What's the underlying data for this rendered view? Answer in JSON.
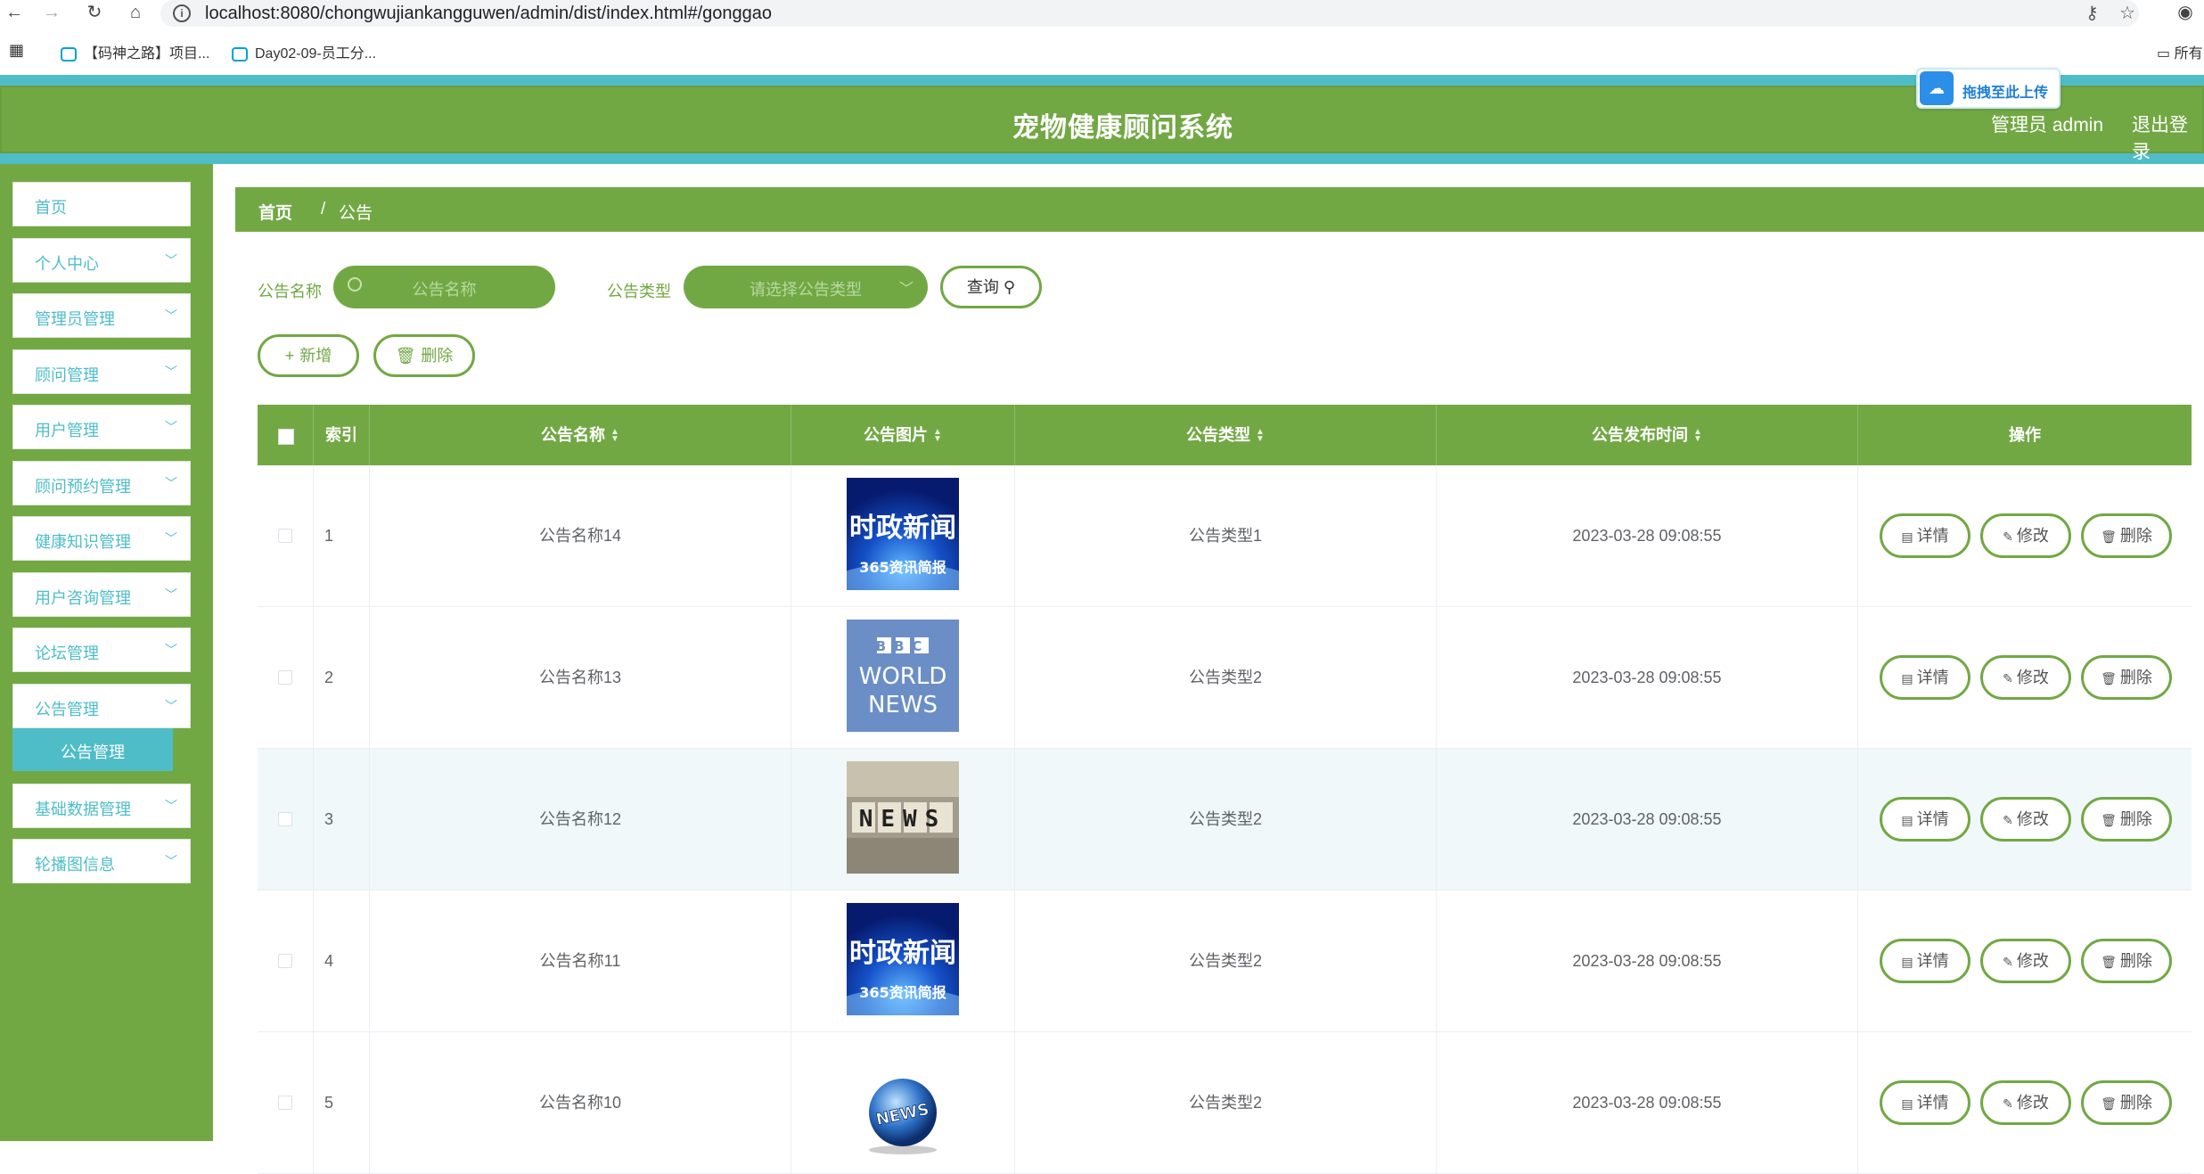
{
  "browser": {
    "url": "localhost:8080/chongwujiankangguwen/admin/dist/index.html#/gonggao",
    "bookmarks": [
      "【码神之路】项目...",
      "Day02-09-员工分..."
    ],
    "bookmarks_right": "所有"
  },
  "header": {
    "title": "宠物健康顾问系统",
    "user": "管理员 admin",
    "logout": "退出登录",
    "upload_chip": "拖拽至此上传"
  },
  "sidebar": {
    "items": [
      {
        "label": "首页",
        "has_children": false
      },
      {
        "label": "个人中心",
        "has_children": true
      },
      {
        "label": "管理员管理",
        "has_children": true
      },
      {
        "label": "顾问管理",
        "has_children": true
      },
      {
        "label": "用户管理",
        "has_children": true
      },
      {
        "label": "顾问预约管理",
        "has_children": true
      },
      {
        "label": "健康知识管理",
        "has_children": true
      },
      {
        "label": "用户咨询管理",
        "has_children": true
      },
      {
        "label": "论坛管理",
        "has_children": true
      },
      {
        "label": "公告管理",
        "has_children": true
      },
      {
        "label": "基础数据管理",
        "has_children": true
      },
      {
        "label": "轮播图信息",
        "has_children": true
      }
    ],
    "active_sub": "公告管理"
  },
  "breadcrumb": {
    "home": "首页",
    "sep": "/",
    "current": "公告"
  },
  "filters": {
    "name_label": "公告名称",
    "name_placeholder": "公告名称",
    "type_label": "公告类型",
    "type_placeholder": "请选择公告类型",
    "query_button": "查询"
  },
  "actions": {
    "add": "新增",
    "delete": "删除"
  },
  "table": {
    "columns": [
      "索引",
      "公告名称",
      "公告图片",
      "公告类型",
      "公告发布时间",
      "操作"
    ],
    "rows": [
      {
        "index": "1",
        "name": "公告名称14",
        "image": "news-cn-blue",
        "type": "公告类型1",
        "time": "2023-03-28 09:08:55"
      },
      {
        "index": "2",
        "name": "公告名称13",
        "image": "bbc-world-news",
        "type": "公告类型2",
        "time": "2023-03-28 09:08:55"
      },
      {
        "index": "3",
        "name": "公告名称12",
        "image": "news-blocks",
        "type": "公告类型2",
        "time": "2023-03-28 09:08:55"
      },
      {
        "index": "4",
        "name": "公告名称11",
        "image": "news-cn-blue",
        "type": "公告类型2",
        "time": "2023-03-28 09:08:55"
      },
      {
        "index": "5",
        "name": "公告名称10",
        "image": "news-globe",
        "type": "公告类型2",
        "time": "2023-03-28 09:08:55"
      }
    ],
    "row_actions": {
      "detail": "详情",
      "edit": "修改",
      "delete": "删除"
    }
  },
  "images": {
    "news_cn_line1": "时政新闻",
    "news_cn_line2": "365资讯简报",
    "bbc_line1": "BBC",
    "bbc_line2": "WORLD",
    "bbc_line3": "NEWS",
    "blocks_text": "NEWS",
    "globe_text": "NEWS"
  },
  "colors": {
    "primary": "#72a844",
    "accent": "#4fbdc8"
  }
}
